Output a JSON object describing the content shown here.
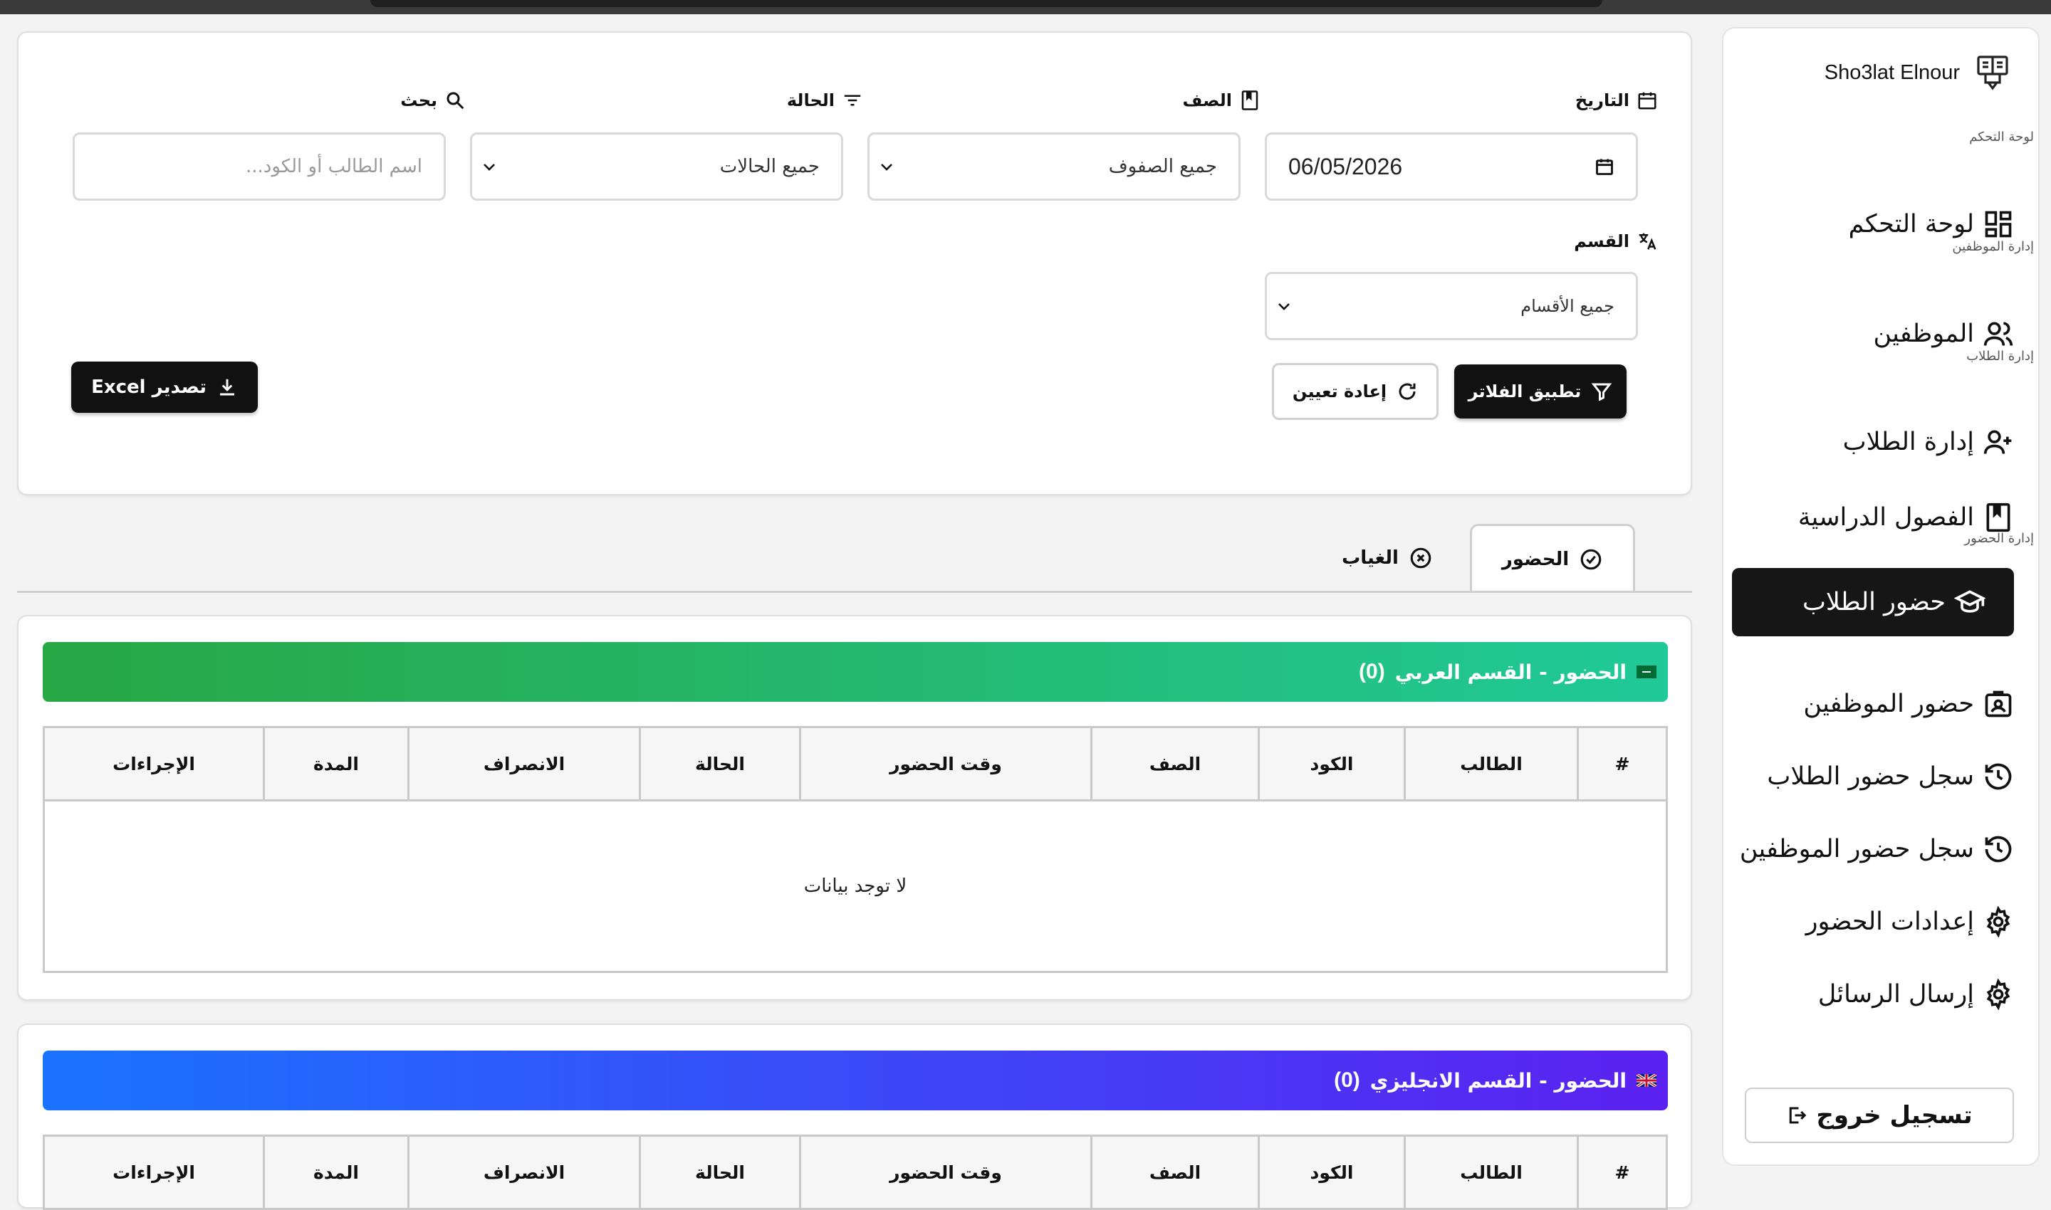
{
  "sidebar": {
    "brand": "Sho3lat Elnour",
    "sections": {
      "dashboard": "لوحة التحكم",
      "staff": "إدارة الموظفين",
      "students": "إدارة الطلاب",
      "attendance": "إدارة الحضور"
    },
    "items": {
      "dashboard": "لوحة التحكم",
      "employees": "الموظفين",
      "students": "إدارة الطلاب",
      "classes": "الفصول الدراسية",
      "student_attendance": "حضور الطلاب",
      "staff_attendance": "حضور الموظفين",
      "student_log": "سجل حضور الطلاب",
      "staff_log": "سجل حضور الموظفين",
      "settings": "إعدادات الحضور",
      "messages": "إرسال الرسائل"
    },
    "logout": "تسجيل خروج"
  },
  "filters": {
    "date_label": "التاريخ",
    "date_value": "06/05/2026",
    "class_label": "الصف",
    "class_value": "جميع الصفوف",
    "status_label": "الحالة",
    "status_value": "جميع الحالات",
    "search_label": "بحث",
    "search_placeholder": "اسم الطالب أو الكود...",
    "dept_label": "القسم",
    "dept_value": "جميع الأقسام",
    "apply": "تطبيق الفلاتر",
    "reset": "إعادة تعيين",
    "export": "تصدير Excel"
  },
  "tabs": {
    "present": "الحضور",
    "absent": "الغياب"
  },
  "sections": {
    "arabic_title": "الحضور - القسم العربي",
    "arabic_count": "(0)",
    "english_title": "الحضور - القسم الانجليزي",
    "english_count": "(0)"
  },
  "table": {
    "columns": [
      "#",
      "الطالب",
      "الكود",
      "الصف",
      "وقت الحضور",
      "الحالة",
      "الانصراف",
      "المدة",
      "الإجراءات"
    ],
    "empty": "لا توجد بيانات"
  },
  "colors": {
    "arabic_banner_start": "#28a745",
    "arabic_banner_end": "#20c997",
    "english_banner_start": "#1a73ff",
    "english_banner_end": "#5b21f0",
    "active_nav": "#161616"
  }
}
